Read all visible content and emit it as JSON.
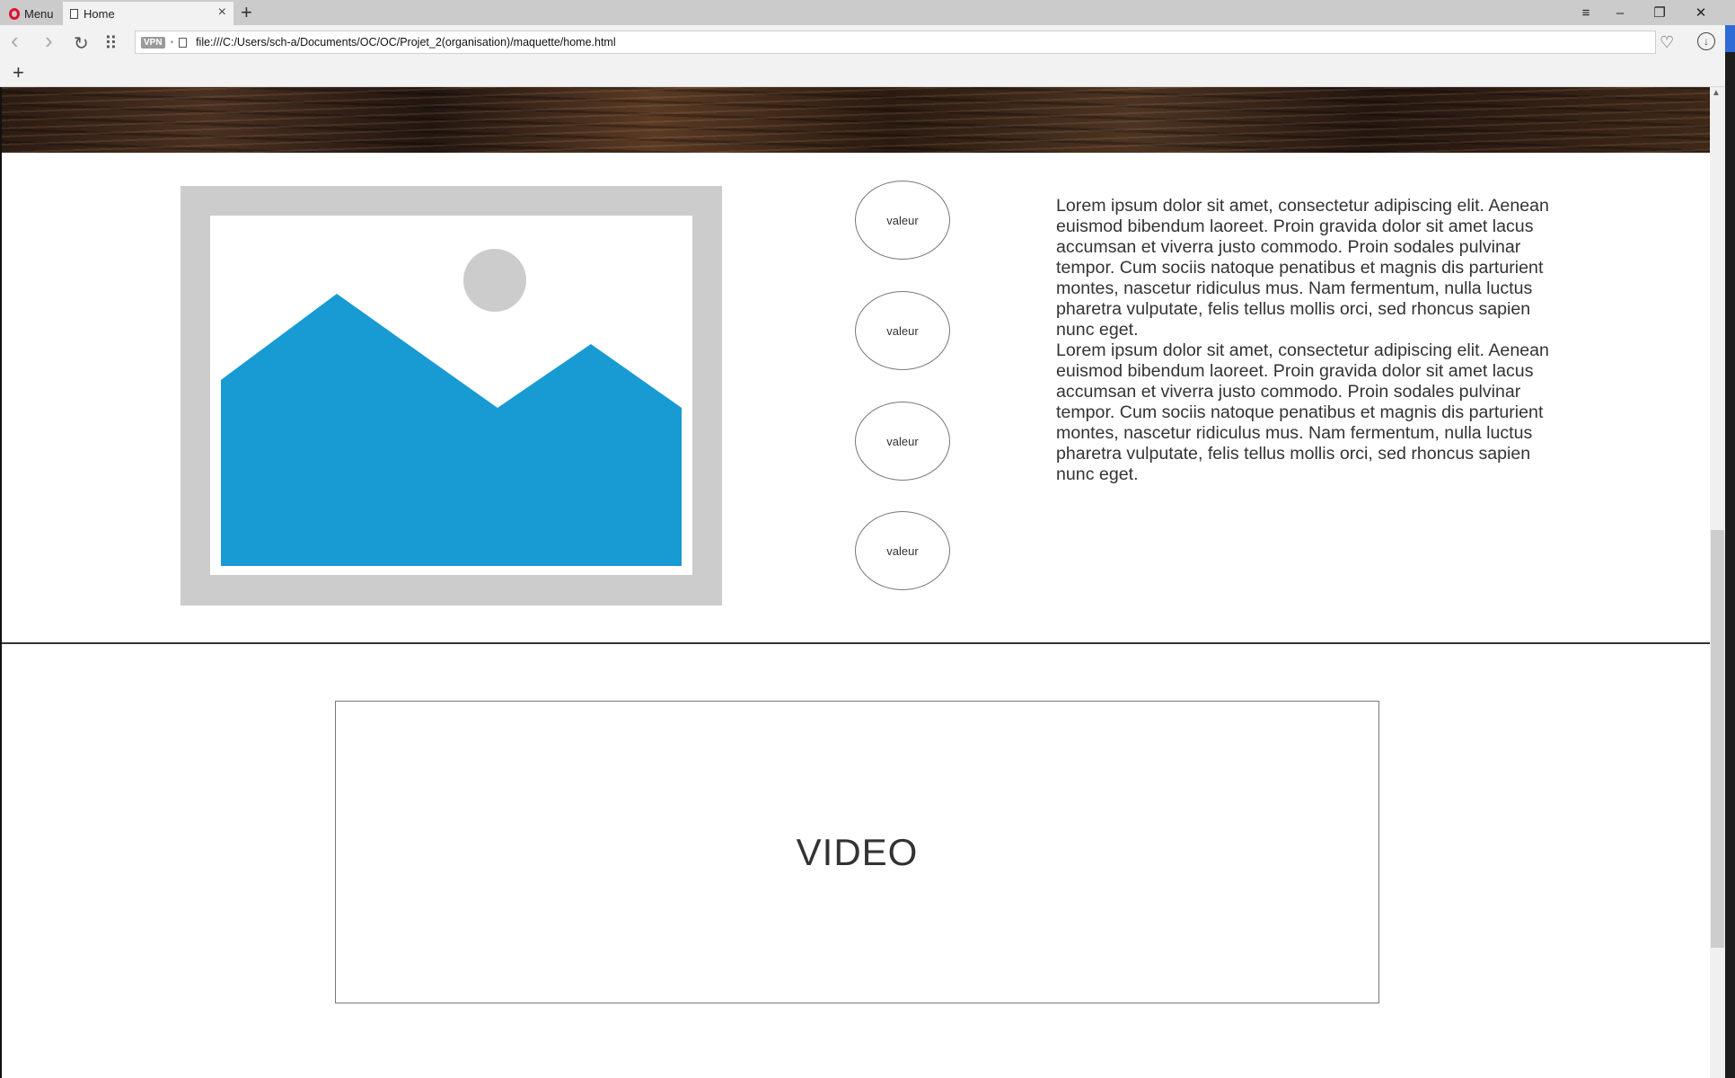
{
  "browser": {
    "menu_label": "Menu",
    "tab_title": "Home",
    "new_tab": "+",
    "tab_close": "×",
    "vpn_label": "VPN",
    "url": "file:///C:/Users/sch-a/Documents/OC/OC/Projet_2(organisation)/maquette/home.html",
    "add_bookmark": "+",
    "window_controls": {
      "tab_menu": "≡",
      "minimize": "–",
      "restore": "❐",
      "close": "✕"
    },
    "nav": {
      "back": "‹",
      "forward": "›",
      "reload": "↻",
      "speed_dial": "⠿"
    },
    "icons": {
      "heart": "♡",
      "download": "↓"
    },
    "accent_color": "#e0102d"
  },
  "page": {
    "values": [
      "valeur",
      "valeur",
      "valeur",
      "valeur"
    ],
    "paragraphs": [
      "Lorem ipsum dolor sit amet, consectetur adipiscing elit. Aenean euismod bibendum laoreet. Proin gravida dolor sit amet lacus accumsan et viverra justo commodo. Proin sodales pulvinar tempor. Cum sociis natoque penatibus et magnis dis parturient montes, nascetur ridiculus mus. Nam fermentum, nulla luctus pharetra vulputate, felis tellus mollis orci, sed rhoncus sapien nunc eget.",
      "Lorem ipsum dolor sit amet, consectetur adipiscing elit. Aenean euismod bibendum laoreet. Proin gravida dolor sit amet lacus accumsan et viverra justo commodo. Proin sodales pulvinar tempor. Cum sociis natoque penatibus et magnis dis parturient montes, nascetur ridiculus mus. Nam fermentum, nulla luctus pharetra vulputate, felis tellus mollis orci, sed rhoncus sapien nunc eget."
    ],
    "video_label": "VIDEO",
    "image_colors": {
      "frame": "#cccccc",
      "mountains": "#189ad3",
      "sun": "#cccccc"
    }
  }
}
